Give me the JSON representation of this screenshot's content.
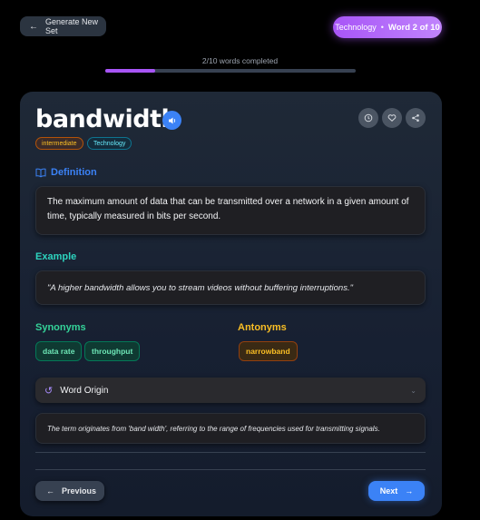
{
  "header": {
    "generate_label": "Generate New Set",
    "category": "Technology",
    "separator": "•",
    "word_position": "Word 2 of 10"
  },
  "progress": {
    "text": "2/10 words completed",
    "completed": 2,
    "total": 10
  },
  "word": {
    "title": "bandwidth",
    "level_tag": "intermediate",
    "category_tag": "Technology"
  },
  "definition": {
    "heading": "Definition",
    "text": "The maximum amount of data that can be transmitted over a network in a given amount of time, typically measured in bits per second."
  },
  "example": {
    "heading": "Example",
    "text": "\"A higher bandwidth allows you to stream videos without buffering interruptions.\""
  },
  "synonyms": {
    "heading": "Synonyms",
    "items": [
      "data rate",
      "throughput"
    ]
  },
  "antonyms": {
    "heading": "Antonyms",
    "items": [
      "narrowband"
    ]
  },
  "origin": {
    "heading": "Word Origin",
    "text": "The term originates from 'band width', referring to the range of frequencies used for transmitting signals."
  },
  "nav": {
    "previous_label": "Previous",
    "next_label": "Next"
  },
  "colors": {
    "accent_purple": "#a855f7",
    "accent_blue": "#3b82f6",
    "synonym_green": "#34d399",
    "antonym_amber": "#fbbf24"
  },
  "icons": [
    "arrow-left-icon",
    "speaker-icon",
    "clock-icon",
    "heart-icon",
    "share-icon",
    "book-icon",
    "history-icon",
    "chevron-down-icon",
    "arrow-right-icon"
  ]
}
